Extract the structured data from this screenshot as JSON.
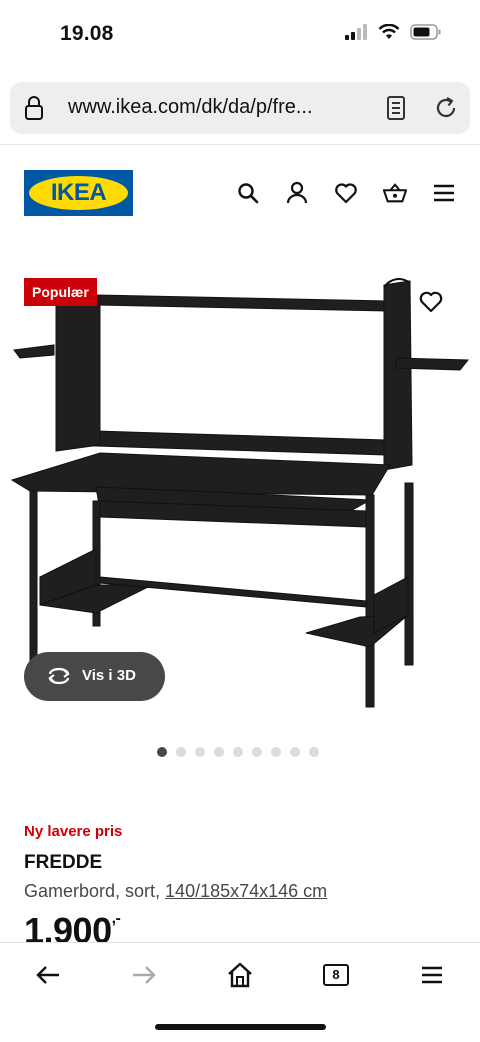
{
  "status": {
    "time": "19.08"
  },
  "browser": {
    "url": "www.ikea.com/dk/da/p/fre..."
  },
  "header": {
    "logo": "IKEA",
    "icons": [
      "search-icon",
      "user-icon",
      "heart-icon",
      "basket-icon",
      "menu-icon"
    ]
  },
  "gallery": {
    "badge": "Populær",
    "view3d_label": "Vis i 3D",
    "dots": 9,
    "active_dot": 0
  },
  "product": {
    "promo": "Ny lavere pris",
    "name": "FREDDE",
    "desc_prefix": "Gamerbord, sort, ",
    "dimensions": "140/185x74x146 cm",
    "price": "1.900",
    "price_suffix": ",-"
  },
  "toolbar": {
    "tabs_count": "8"
  },
  "colors": {
    "ikea_blue": "#0058a3",
    "ikea_yellow": "#ffdb00",
    "promo_red": "#cc0008"
  }
}
